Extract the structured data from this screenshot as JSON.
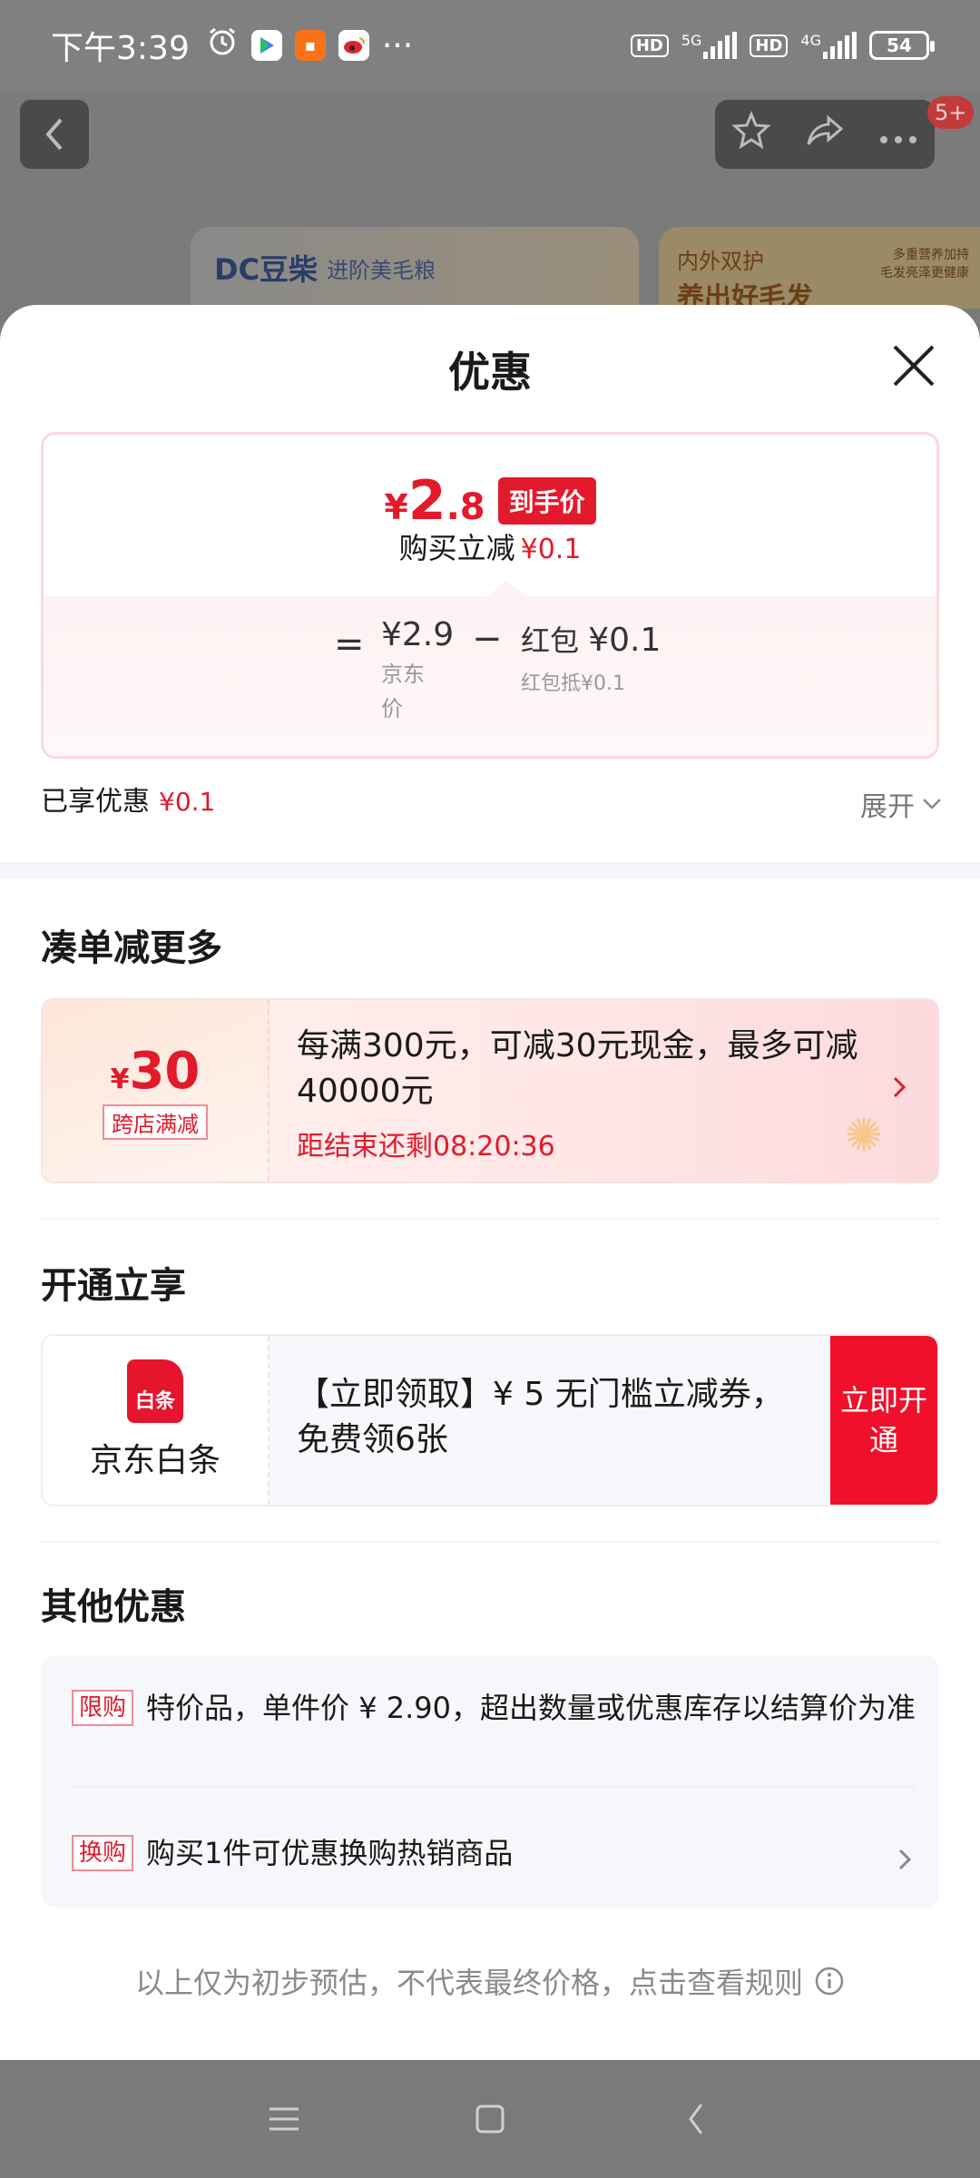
{
  "status_bar": {
    "time": "下午3:39",
    "more": "···",
    "network_1": "5G",
    "network_2": "4G",
    "hd": "HD",
    "battery": "54"
  },
  "header": {
    "notification_count": "5+",
    "banner_logo": "DC豆柴",
    "banner_text": "进阶美毛粮",
    "banner_right_line1": "内外双护",
    "banner_right_line2": "养出好毛发",
    "banner_right_small": "多重营养加持\n毛发亮泽更健康"
  },
  "sheet": {
    "title": "优惠",
    "price_card": {
      "yen": "¥",
      "final_int": "2",
      "final_dec": ".8",
      "arrival_label": "到手价",
      "reduce_label": "购买立减",
      "reduce_value": "¥0.1",
      "eq": "=",
      "jd_price": "¥2.9",
      "jd_label": "京东价",
      "minus": "−",
      "hongbao_label": "红包",
      "hongbao_value": "¥0.1",
      "hongbao_note": "红包抵¥0.1"
    },
    "enjoyed_label": "已享优惠",
    "enjoyed_value": "¥0.1",
    "expand_label": "展开",
    "section_more": "凑单减更多",
    "promo": {
      "yen": "¥",
      "amount": "30",
      "tag": "跨店满减",
      "text": "每满300元，可减30元现金，最多可减40000元",
      "countdown": "距结束还剩08:20:36"
    },
    "section_open": "开通立享",
    "baitiao": {
      "logo_text": "白条",
      "name": "京东白条",
      "text": "【立即领取】¥ 5 无门槛立减券，免费领6张",
      "button": "立即开通"
    },
    "section_other": "其他优惠",
    "other": [
      {
        "tag": "限购",
        "text": "特价品，单件价 ¥ 2.90，超出数量或优惠库存以结算价为准"
      },
      {
        "tag": "换购",
        "text": "购买1件可优惠换购热销商品"
      }
    ],
    "footnote": "以上仅为初步预估，不代表最终价格，点击查看规则"
  }
}
